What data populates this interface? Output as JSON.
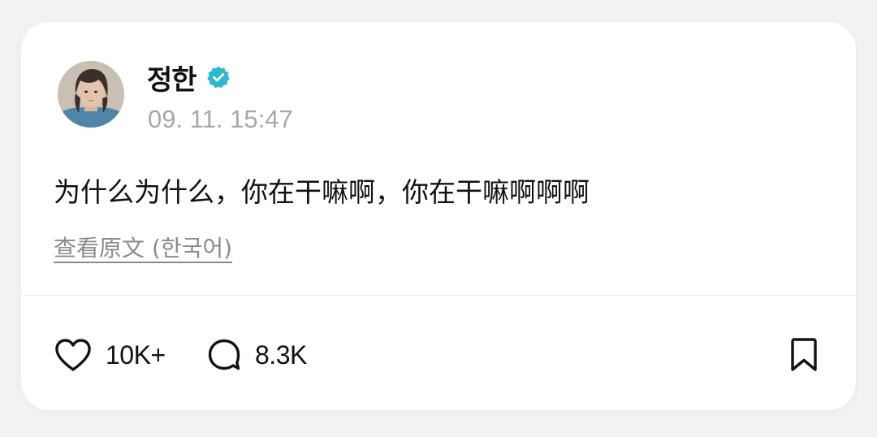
{
  "post": {
    "author": {
      "name": "정한",
      "verified": true,
      "avatar_icon": "profile-photo"
    },
    "timestamp": "09. 11. 15:47",
    "text": "为什么为什么，你在干嘛啊，你在干嘛啊啊啊",
    "translate_link": "查看原文 (한국어)"
  },
  "actions": {
    "like": {
      "icon": "heart-icon",
      "count": "10K+"
    },
    "reply": {
      "icon": "comment-bubble-icon",
      "count": "8.3K"
    },
    "bookmark": {
      "icon": "bookmark-icon"
    }
  },
  "colors": {
    "verified_badge": "#2bb9d0",
    "text_primary": "#111111",
    "text_secondary": "#a7a7ab",
    "card_background": "#ffffff",
    "page_background": "#f2f2f4"
  }
}
